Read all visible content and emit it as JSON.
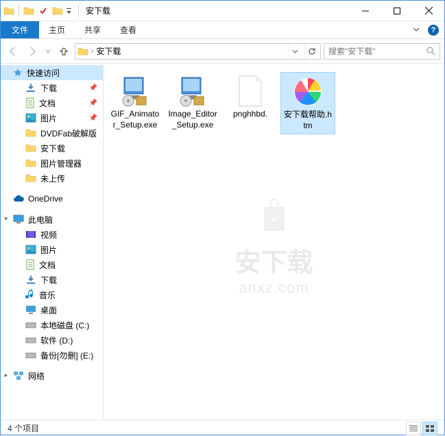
{
  "window": {
    "title": "安下载"
  },
  "tabs": {
    "file": "文件",
    "home": "主页",
    "share": "共享",
    "view": "查看"
  },
  "address": {
    "path": "安下载"
  },
  "search": {
    "placeholder": "搜索\"安下载\""
  },
  "sidebar": {
    "quick_access": "快速访问",
    "items_qa": [
      {
        "label": "下载",
        "icon": "download",
        "pinned": true
      },
      {
        "label": "文档",
        "icon": "document",
        "pinned": true
      },
      {
        "label": "图片",
        "icon": "picture",
        "pinned": true
      },
      {
        "label": "DVDFab破解版",
        "icon": "folder",
        "pinned": false
      },
      {
        "label": "安下载",
        "icon": "folder",
        "pinned": false
      },
      {
        "label": "图片管理器",
        "icon": "folder",
        "pinned": false
      },
      {
        "label": "未上传",
        "icon": "folder",
        "pinned": false
      }
    ],
    "onedrive": "OneDrive",
    "thispc": "此电脑",
    "items_pc": [
      {
        "label": "视频",
        "icon": "video"
      },
      {
        "label": "图片",
        "icon": "picture"
      },
      {
        "label": "文档",
        "icon": "document"
      },
      {
        "label": "下载",
        "icon": "download"
      },
      {
        "label": "音乐",
        "icon": "music"
      },
      {
        "label": "桌面",
        "icon": "desktop"
      },
      {
        "label": "本地磁盘 (C:)",
        "icon": "disk"
      },
      {
        "label": "软件 (D:)",
        "icon": "disk"
      },
      {
        "label": "备份[勿删] (E:)",
        "icon": "disk"
      }
    ],
    "network": "网络"
  },
  "files": [
    {
      "name": "GIF_Animator_Setup.exe",
      "type": "exe",
      "selected": false
    },
    {
      "name": "Image_Editor_Setup.exe",
      "type": "exe",
      "selected": false
    },
    {
      "name": "pnghhbd.",
      "type": "blank",
      "selected": false
    },
    {
      "name": "安下载帮助.htm",
      "type": "htm",
      "selected": true
    }
  ],
  "status": {
    "count": "4 个项目"
  },
  "watermark": {
    "title": "安下载",
    "sub": "anxz.com"
  }
}
